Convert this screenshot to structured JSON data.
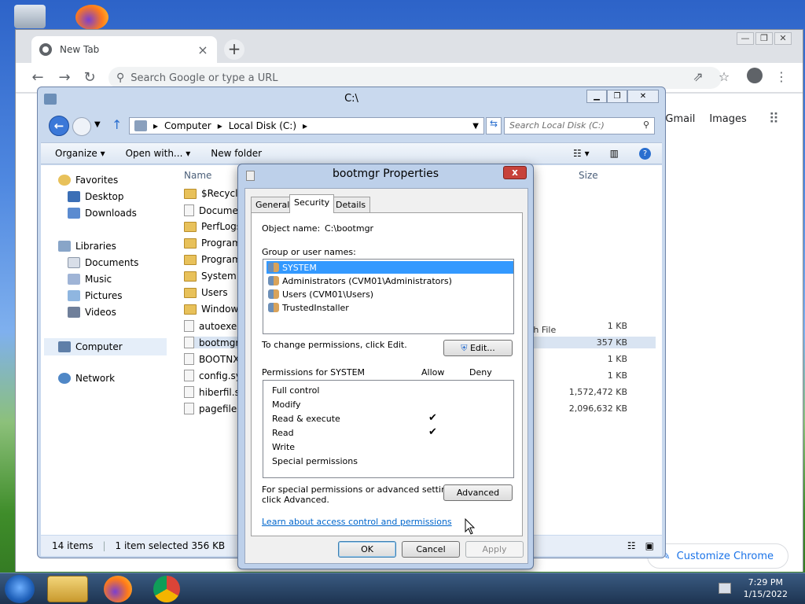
{
  "chrome": {
    "tab_title": "New Tab",
    "tab_close": "×",
    "new_tab": "+",
    "win_min": "—",
    "win_max": "❐",
    "win_close": "✕",
    "omnibox_placeholder": "Search Google or type a URL",
    "links": {
      "gmail": "Gmail",
      "images": "Images"
    },
    "customize": "Customize Chrome"
  },
  "explorer": {
    "title": "C:\\",
    "breadcrumb": [
      "Computer",
      "Local Disk (C:)"
    ],
    "search_placeholder": "Search Local Disk (C:)",
    "commands": {
      "organize": "Organize ▾",
      "open_with": "Open with... ▾",
      "new_folder": "New folder"
    },
    "columns": {
      "name": "Name",
      "size": "Size"
    },
    "nav": {
      "favorites": "Favorites",
      "desktop": "Desktop",
      "downloads": "Downloads",
      "libraries": "Libraries",
      "documents": "Documents",
      "music": "Music",
      "pictures": "Pictures",
      "videos": "Videos",
      "computer": "Computer",
      "network": "Network"
    },
    "files": [
      {
        "name": "$Recycle.",
        "type": "folder",
        "size": ""
      },
      {
        "name": "Documen",
        "type": "link",
        "size": ""
      },
      {
        "name": "PerfLogs",
        "type": "folder",
        "size": ""
      },
      {
        "name": "Program",
        "type": "folder",
        "size": ""
      },
      {
        "name": "Program",
        "type": "folder",
        "size": ""
      },
      {
        "name": "System V",
        "type": "folder",
        "size": ""
      },
      {
        "name": "Users",
        "type": "folder",
        "size": ""
      },
      {
        "name": "Windows",
        "type": "folder",
        "size": ""
      },
      {
        "name": "autoexec",
        "type": "file",
        "size": "1 KB"
      },
      {
        "name": "bootmgr",
        "type": "file",
        "size": "357 KB"
      },
      {
        "name": "BOOTNX",
        "type": "file",
        "size": "1 KB"
      },
      {
        "name": "config.sy",
        "type": "file",
        "size": "1 KB"
      },
      {
        "name": "hiberfil.sy",
        "type": "file",
        "size": "1,572,472 KB"
      },
      {
        "name": "pagefile.s",
        "type": "file",
        "size": "2,096,632 KB"
      }
    ],
    "type_fragment": "tch File",
    "status": {
      "count": "14 items",
      "selected": "1 item selected  356 KB"
    }
  },
  "dialog": {
    "title": "bootmgr Properties",
    "close": "x",
    "tabs": [
      "General",
      "Security",
      "Details"
    ],
    "object_label": "Object name:",
    "object_value": "C:\\bootmgr",
    "group_label": "Group or user names:",
    "users": [
      "SYSTEM",
      "Administrators (CVM01\\Administrators)",
      "Users (CVM01\\Users)",
      "TrustedInstaller"
    ],
    "change_text": "To change permissions, click Edit.",
    "edit_button": "Edit...",
    "perms_label": "Permissions for SYSTEM",
    "allow": "Allow",
    "deny": "Deny",
    "permissions": [
      {
        "name": "Full control",
        "allow": ""
      },
      {
        "name": "Modify",
        "allow": ""
      },
      {
        "name": "Read & execute",
        "allow": "✔"
      },
      {
        "name": "Read",
        "allow": "✔"
      },
      {
        "name": "Write",
        "allow": ""
      },
      {
        "name": "Special permissions",
        "allow": ""
      }
    ],
    "special_text_1": "For special permissions or advanced settings,",
    "special_text_2": "click Advanced.",
    "advanced_button": "Advanced",
    "learn_link": "Learn about access control and permissions",
    "ok": "OK",
    "cancel": "Cancel",
    "apply": "Apply"
  },
  "taskbar": {
    "time": "7:29 PM",
    "date": "1/15/2022"
  }
}
